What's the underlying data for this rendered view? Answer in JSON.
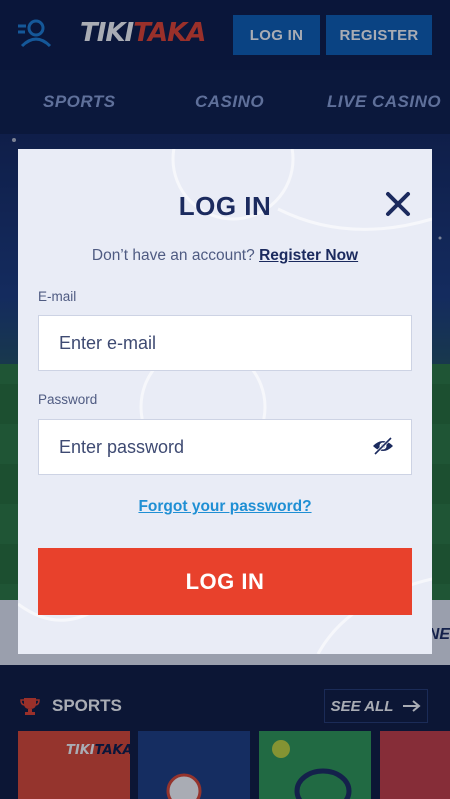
{
  "header": {
    "logo_part1": "TIKI",
    "logo_part2": "TAKA",
    "login_label": "LOG IN",
    "register_label": "REGISTER"
  },
  "nav": {
    "items": [
      {
        "label": "SPORTS"
      },
      {
        "label": "CASINO"
      },
      {
        "label": "LIVE CASINO"
      }
    ]
  },
  "promo": {
    "partial_text": "NE"
  },
  "sports_section": {
    "heading": "SPORTS",
    "see_all_label": "SEE ALL",
    "tile1_logo_part1": "TIKI",
    "tile1_logo_part2": "TAKA"
  },
  "modal": {
    "title": "LOG IN",
    "signup_prompt": "Don’t have an account?",
    "signup_link": "Register Now",
    "email_label": "E-mail",
    "email_placeholder": "Enter e-mail",
    "email_value": "",
    "password_label": "Password",
    "password_placeholder": "Enter password",
    "password_value": "",
    "forgot_link": "Forgot your password?",
    "submit_label": "LOG IN"
  },
  "colors": {
    "brand_red": "#e8412c",
    "brand_blue": "#0b5fb4",
    "navy": "#1b2a5e",
    "link_blue": "#1f8fd4"
  },
  "icons": [
    "user-icon",
    "close-icon",
    "eye-slash-icon",
    "trophy-icon",
    "arrow-right-icon"
  ]
}
